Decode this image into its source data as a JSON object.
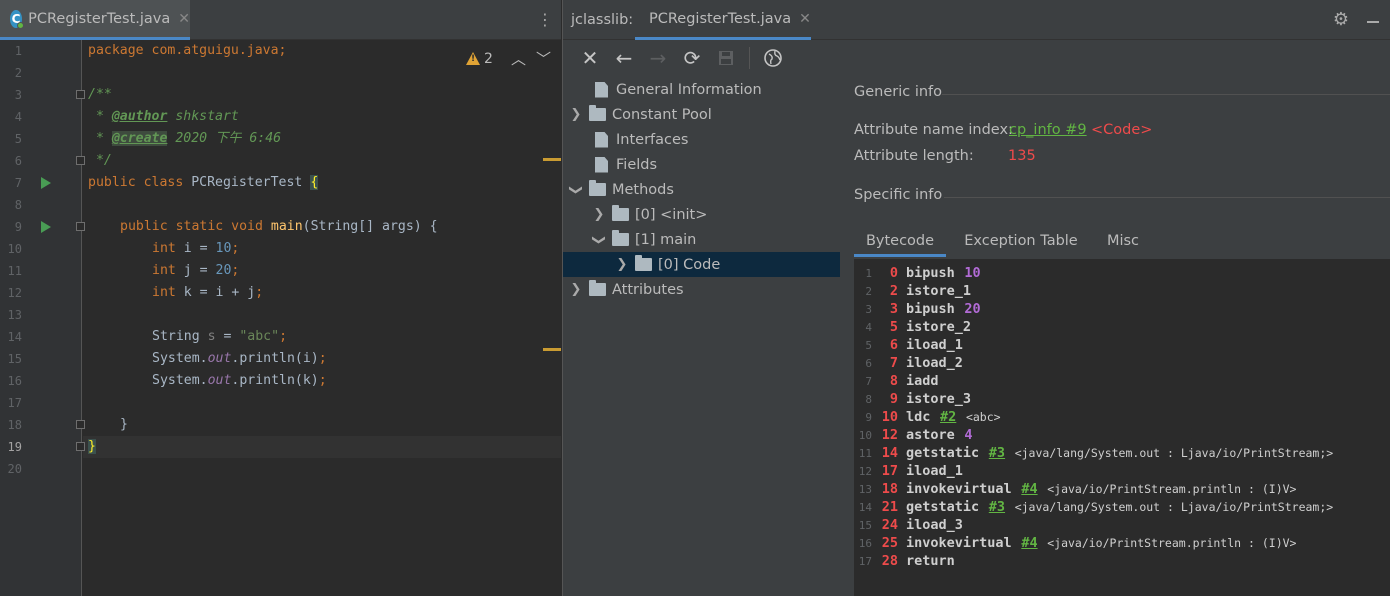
{
  "editor": {
    "tab_label": "PCRegisterTest.java",
    "warning_count": "2",
    "line_numbers": [
      "1",
      "2",
      "3",
      "4",
      "5",
      "6",
      "7",
      "8",
      "9",
      "10",
      "11",
      "12",
      "13",
      "14",
      "15",
      "16",
      "17",
      "18",
      "19",
      "20"
    ],
    "code": {
      "l1_kw": "package",
      "l1_rest": " com.atguigu.java;",
      "l3": "/**",
      "l4_star": " * ",
      "l4_tag": "@author",
      "l4_rest": " shkstart",
      "l5_star": " * ",
      "l5_tag": "@create",
      "l5_rest": " 2020 下午 6:46",
      "l6": " */",
      "l7_kw": "public class",
      "l7_name": " PCRegisterTest ",
      "l7_brace": "{",
      "l9_kw": "public static void",
      "l9_fn": "main",
      "l9_rest": "(String[] args) {",
      "l10_kw": "int",
      "l10_mid": " i = ",
      "l10_num": "10",
      "l10_end": ";",
      "l11_kw": "int",
      "l11_mid": " j = ",
      "l11_num": "20",
      "l11_end": ";",
      "l12_kw": "int",
      "l12_mid": " k = i + j",
      "l12_end": ";",
      "l14_type": "String ",
      "l14_var": "s",
      "l14_eq": " = ",
      "l14_str": "\"abc\"",
      "l14_end": ";",
      "l15_a": "System.",
      "l15_f": "out",
      "l15_b": ".println(i)",
      "l15_end": ";",
      "l16_a": "System.",
      "l16_f": "out",
      "l16_b": ".println(k)",
      "l16_end": ";",
      "l18": "}",
      "l19": "}"
    }
  },
  "jclasslib": {
    "title": "jclasslib:",
    "tab_label": "PCRegisterTest.java",
    "toolbar_icons": [
      "close-icon",
      "back-icon",
      "forward-icon",
      "refresh-icon",
      "save-icon",
      "web-icon"
    ],
    "tree": [
      {
        "label": "General Information",
        "icon": "file"
      },
      {
        "label": "Constant Pool",
        "icon": "folder"
      },
      {
        "label": "Interfaces",
        "icon": "file"
      },
      {
        "label": "Fields",
        "icon": "file"
      },
      {
        "label": "Methods",
        "icon": "folder"
      },
      {
        "label": "[0] <init>",
        "icon": "folder"
      },
      {
        "label": "[1] main",
        "icon": "folder"
      },
      {
        "label": "[0] Code",
        "icon": "folder"
      },
      {
        "label": "Attributes",
        "icon": "folder"
      }
    ],
    "generic_info": {
      "title": "Generic info",
      "name_index_label": "Attribute name index:",
      "name_index_link": "cp_info #9",
      "name_index_value": "<Code>",
      "length_label": "Attribute length:",
      "length_value": "135"
    },
    "specific_info_title": "Specific info",
    "tabs": [
      "Bytecode",
      "Exception Table",
      "Misc"
    ],
    "bytecode": [
      {
        "n": "1",
        "off": "0",
        "op": "bipush",
        "arg": "10"
      },
      {
        "n": "2",
        "off": "2",
        "op": "istore_1"
      },
      {
        "n": "3",
        "off": "3",
        "op": "bipush",
        "arg": "20"
      },
      {
        "n": "4",
        "off": "5",
        "op": "istore_2"
      },
      {
        "n": "5",
        "off": "6",
        "op": "iload_1"
      },
      {
        "n": "6",
        "off": "7",
        "op": "iload_2"
      },
      {
        "n": "7",
        "off": "8",
        "op": "iadd"
      },
      {
        "n": "8",
        "off": "9",
        "op": "istore_3"
      },
      {
        "n": "9",
        "off": "10",
        "op": "ldc",
        "ref": "#2",
        "cm": "<abc>"
      },
      {
        "n": "10",
        "off": "12",
        "op": "astore",
        "arg": "4"
      },
      {
        "n": "11",
        "off": "14",
        "op": "getstatic",
        "ref": "#3",
        "cm": "<java/lang/System.out : Ljava/io/PrintStream;>"
      },
      {
        "n": "12",
        "off": "17",
        "op": "iload_1"
      },
      {
        "n": "13",
        "off": "18",
        "op": "invokevirtual",
        "ref": "#4",
        "cm": "<java/io/PrintStream.println : (I)V>"
      },
      {
        "n": "14",
        "off": "21",
        "op": "getstatic",
        "ref": "#3",
        "cm": "<java/lang/System.out : Ljava/io/PrintStream;>"
      },
      {
        "n": "15",
        "off": "24",
        "op": "iload_3"
      },
      {
        "n": "16",
        "off": "25",
        "op": "invokevirtual",
        "ref": "#4",
        "cm": "<java/io/PrintStream.println : (I)V>"
      },
      {
        "n": "17",
        "off": "28",
        "op": "return"
      }
    ]
  },
  "colors": {
    "accent": "#4a88c7",
    "keyword": "#cc7832",
    "number": "#6897bb",
    "string": "#6a8759",
    "offset_red": "#ee4b4b",
    "link_green": "#62b543"
  }
}
